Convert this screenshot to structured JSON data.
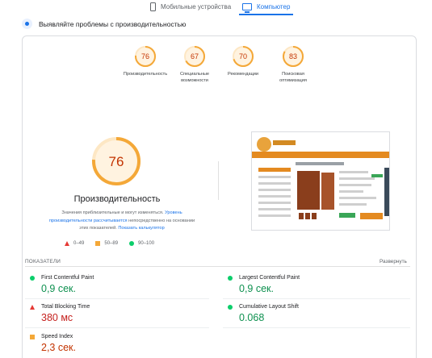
{
  "tabs": {
    "mobile": "Мобильные устройства",
    "desktop": "Компьютер"
  },
  "headline": "Выявляйте проблемы с производительностью",
  "categories": [
    {
      "score": "76",
      "label": "Производительность"
    },
    {
      "score": "67",
      "label": "Специальные возможности"
    },
    {
      "score": "70",
      "label": "Рекомендации"
    },
    {
      "score": "83",
      "label": "Поисковая оптимизация"
    }
  ],
  "performance": {
    "score": "76",
    "score_value": 0.76,
    "title": "Производительность",
    "desc_prefix": "Значения приблизительные и могут изменяться.",
    "desc_link1": "Уровень производительности рассчитывается",
    "desc_middle": "непосредственно на основании этих показателей.",
    "desc_link2": "Показать калькулятор"
  },
  "legend": {
    "red": "0–49",
    "orange": "50–89",
    "green": "90–100"
  },
  "metrics": {
    "header": "ПОКАЗАТЕЛИ",
    "expand": "Развернуть",
    "items": [
      {
        "name": "First Contentful Paint",
        "value": "0,9 сек.",
        "status": "green"
      },
      {
        "name": "Largest Contentful Paint",
        "value": "0,9 сек.",
        "status": "green"
      },
      {
        "name": "Total Blocking Time",
        "value": "380 мс",
        "status": "red"
      },
      {
        "name": "Cumulative Layout Shift",
        "value": "0.068",
        "status": "green"
      },
      {
        "name": "Speed Index",
        "value": "2,3 сек.",
        "status": "orange"
      }
    ]
  },
  "colors": {
    "accent": "#1a73e8",
    "average": "#f4a838",
    "good": "#0cce6b",
    "poor": "#e53935"
  }
}
